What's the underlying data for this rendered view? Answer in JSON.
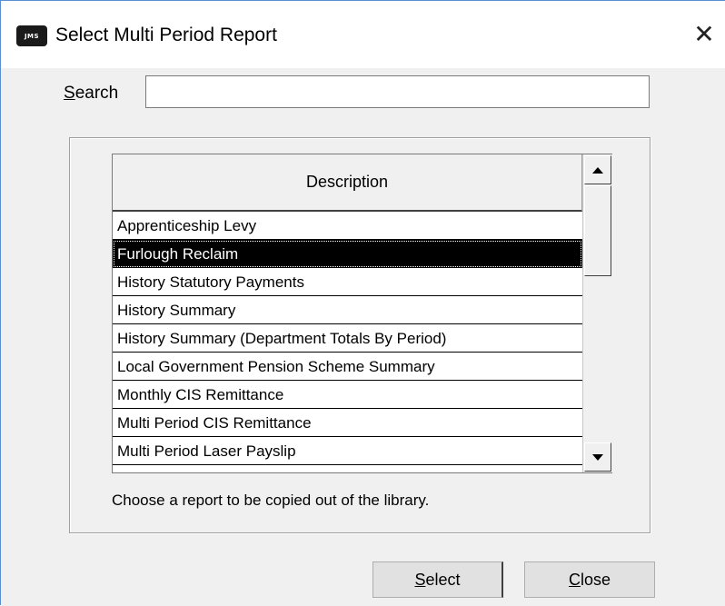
{
  "window": {
    "title": "Select Multi Period Report",
    "app_icon_text": "JMS",
    "close_glyph": "✕"
  },
  "search": {
    "label_access": "S",
    "label_rest": "earch",
    "value": "",
    "placeholder": ""
  },
  "list": {
    "column_header": "Description",
    "selected_index": 1,
    "items": [
      "Apprenticeship Levy",
      "Furlough Reclaim",
      "History Statutory Payments",
      "History Summary",
      "History Summary (Department Totals By Period)",
      "Local Government Pension Scheme Summary",
      "Monthly CIS Remittance",
      "Multi Period CIS Remittance",
      "Multi Period Laser Payslip"
    ]
  },
  "hint_text": "Choose a report to be copied out of the library.",
  "buttons": {
    "select_access": "S",
    "select_rest": "elect",
    "close_access": "C",
    "close_rest": "lose"
  },
  "icons": {
    "scroll_up": "triangle-up-icon",
    "scroll_down": "triangle-down-icon",
    "close": "close-icon"
  }
}
